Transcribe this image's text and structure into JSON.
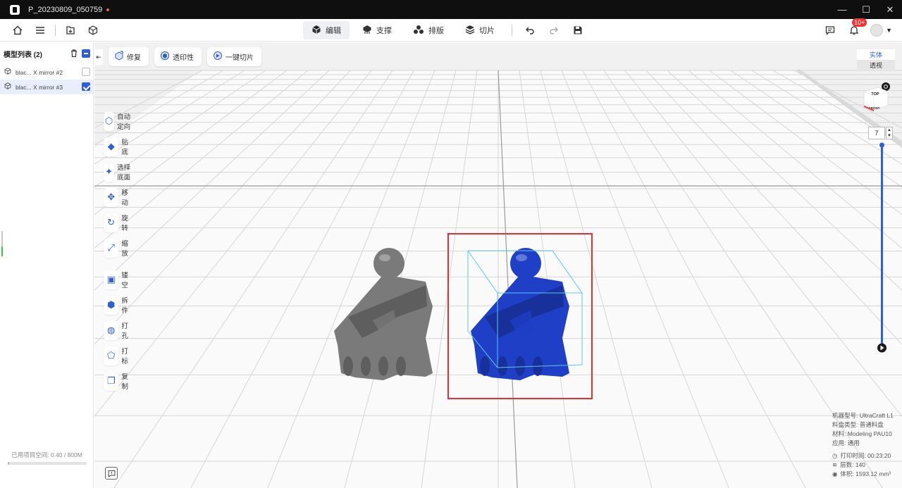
{
  "window": {
    "title": "P_20230809_050759",
    "minimize": "—",
    "maximize": "☐",
    "close": "✕"
  },
  "toolbar": {
    "tabs": [
      {
        "label": "编辑",
        "icon": "cube-icon",
        "active": true
      },
      {
        "label": "支撑",
        "icon": "support-icon",
        "active": false
      },
      {
        "label": "排版",
        "icon": "layout-icon",
        "active": false
      },
      {
        "label": "切片",
        "icon": "slice-icon",
        "active": false
      }
    ],
    "notification_count": "10+"
  },
  "model_list": {
    "title": "模型列表 (2)",
    "items": [
      {
        "name": "blac... X mirror #2",
        "checked": false
      },
      {
        "name": "blac... X mirror #3",
        "checked": true
      }
    ],
    "space_label": "已用项目空间: 0.40 / 800M",
    "space_fraction": 0.0005
  },
  "actions": [
    {
      "label": "修复",
      "icon": "repair-icon"
    },
    {
      "label": "透印性",
      "icon": "printability-icon"
    },
    {
      "label": "一键切片",
      "icon": "one-click-slice-icon"
    }
  ],
  "side_tools": [
    {
      "label": "自动定向",
      "icon": "auto-orient-icon"
    },
    {
      "label": "贴底",
      "icon": "lay-flat-icon"
    },
    {
      "label": "选择底面",
      "icon": "select-bottom-icon"
    },
    {
      "label": "移动",
      "icon": "move-icon"
    },
    {
      "label": "旋转",
      "icon": "rotate-icon"
    },
    {
      "label": "缩放",
      "icon": "scale-icon"
    },
    {
      "label": "镂空",
      "icon": "hollow-icon"
    },
    {
      "label": "拆件",
      "icon": "split-icon"
    },
    {
      "label": "打孔",
      "icon": "punch-hole-icon"
    },
    {
      "label": "打标",
      "icon": "label-icon"
    },
    {
      "label": "复制",
      "icon": "copy-icon"
    }
  ],
  "view_mode": {
    "solid": "实体",
    "transparent": "透视"
  },
  "viewcube": {
    "top": "TOP",
    "front": "FRONT"
  },
  "zoom_value": "7",
  "info": {
    "machine": "机器型号:  UltraCraft L1",
    "tray": "料盘类型:  普通料盘",
    "material": "材料:  Modeling PAU10",
    "application": "应用:  通用",
    "print_time": "打印时间: 00:23:20",
    "layers": "层数: 140",
    "volume": "体积: 1593.12 mm³"
  },
  "colors": {
    "accent": "#2f5fd6",
    "selected_model": "#1f3fc6",
    "other_model": "#7a7a7a",
    "selection_box": "#e53030",
    "bounding_box": "#5ac8f0"
  }
}
